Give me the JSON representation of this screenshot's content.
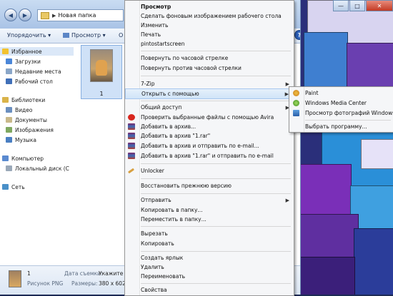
{
  "window": {
    "address_folder": "Новая папка",
    "nav_back": "◀",
    "nav_forward": "▶",
    "min_label": "—",
    "max_label": "□",
    "close_label": "✕",
    "help_label": "?"
  },
  "toolbar": {
    "organize_label": "Упорядочить ▾",
    "view_label": "Просмотр ▾",
    "truncated_label": "О"
  },
  "sidebar": {
    "items": [
      {
        "label": "Избранное"
      },
      {
        "label": "Загрузки"
      },
      {
        "label": "Недавние места"
      },
      {
        "label": "Рабочий стол"
      },
      {
        "label": "Библиотеки"
      },
      {
        "label": "Видео"
      },
      {
        "label": "Документы"
      },
      {
        "label": "Изображения"
      },
      {
        "label": "Музыка"
      },
      {
        "label": "Компьютер"
      },
      {
        "label": "Локальный диск (C"
      },
      {
        "label": "Сеть"
      }
    ]
  },
  "content": {
    "file_label": "1"
  },
  "details": {
    "name": "1",
    "type": "Рисунок PNG",
    "date_label": "Дата съемки:",
    "date_value": "Укажите д",
    "size_label": "Размеры:",
    "size_value": "380 x 602"
  },
  "context_menu": {
    "items": [
      {
        "label": "Просмотр"
      },
      {
        "label": "Сделать фоновым изображением рабочего стола"
      },
      {
        "label": "Изменить"
      },
      {
        "label": "Печать"
      },
      {
        "label": "pintostartscreen"
      },
      {
        "label": "Повернуть по часовой стрелке"
      },
      {
        "label": "Повернуть против часовой стрелки"
      },
      {
        "label": "7-Zip"
      },
      {
        "label": "Открыть с помощью"
      },
      {
        "label": "Общий доступ"
      },
      {
        "label": "Проверить выбранные файлы с помощью Avira"
      },
      {
        "label": "Добавить в архив..."
      },
      {
        "label": "Добавить в архив \"1.rar\""
      },
      {
        "label": "Добавить в архив и отправить по e-mail..."
      },
      {
        "label": "Добавить в архив \"1.rar\" и отправить по e-mail"
      },
      {
        "label": "Unlocker"
      },
      {
        "label": "Восстановить прежнюю версию"
      },
      {
        "label": "Отправить"
      },
      {
        "label": "Копировать в папку..."
      },
      {
        "label": "Переместить в папку..."
      },
      {
        "label": "Вырезать"
      },
      {
        "label": "Копировать"
      },
      {
        "label": "Создать ярлык"
      },
      {
        "label": "Удалить"
      },
      {
        "label": "Переименовать"
      },
      {
        "label": "Свойства"
      }
    ],
    "submenu_arrow": "▶"
  },
  "open_with_submenu": {
    "items": [
      {
        "label": "Paint"
      },
      {
        "label": "Windows Media Center"
      },
      {
        "label": "Просмотр фотографий Windows"
      },
      {
        "label": "Выбрать программу..."
      }
    ]
  },
  "colors": {
    "accent": "#2b5fb8",
    "highlight": "#d0e4f8"
  }
}
